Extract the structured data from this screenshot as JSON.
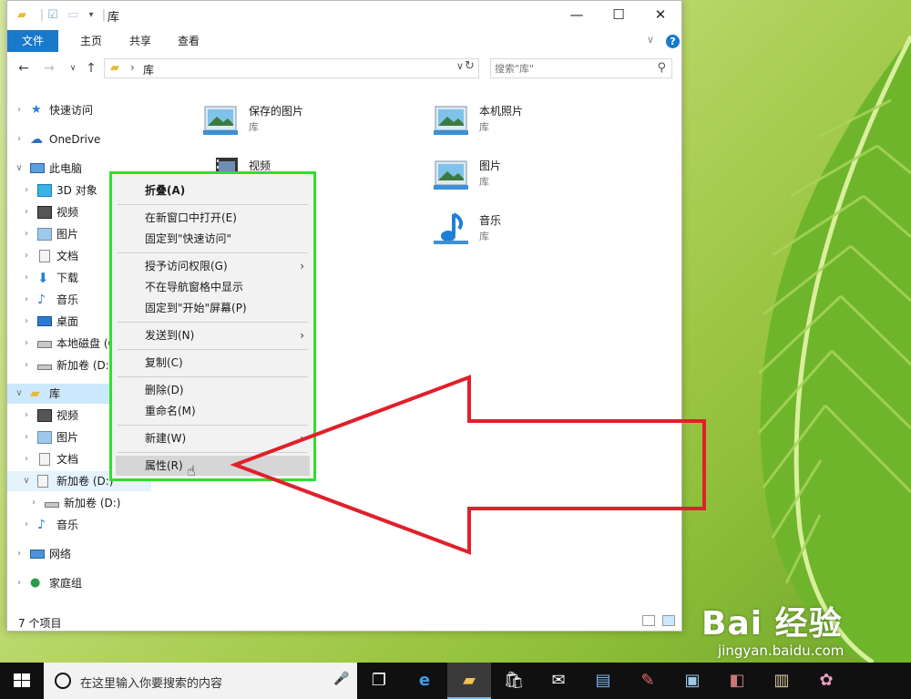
{
  "window": {
    "title": "库",
    "controls": {
      "minimize": "—",
      "maximize": "☐",
      "close": "✕"
    }
  },
  "ribbon": {
    "tabs": [
      {
        "label": "文件"
      },
      {
        "label": "主页"
      },
      {
        "label": "共享"
      },
      {
        "label": "查看"
      }
    ],
    "help": "?"
  },
  "address": {
    "path": "库",
    "separator": "›"
  },
  "search": {
    "placeholder": "搜索\"库\""
  },
  "nav_pane": {
    "items": [
      {
        "label": "快速访问",
        "icon": "star-icon"
      },
      {
        "label": "OneDrive",
        "icon": "cloud-icon"
      },
      {
        "label": "此电脑",
        "icon": "computer-icon"
      },
      {
        "label": "3D 对象",
        "icon": "cube-icon"
      },
      {
        "label": "视频",
        "icon": "video-icon"
      },
      {
        "label": "图片",
        "icon": "picture-icon"
      },
      {
        "label": "文档",
        "icon": "document-icon"
      },
      {
        "label": "下载",
        "icon": "download-icon"
      },
      {
        "label": "音乐",
        "icon": "music-icon"
      },
      {
        "label": "桌面",
        "icon": "desktop-icon"
      },
      {
        "label": "本地磁盘 (C",
        "icon": "drive-icon"
      },
      {
        "label": "新加卷 (D:)",
        "icon": "drive-icon"
      },
      {
        "label": "库",
        "icon": "library-icon"
      },
      {
        "label": "视频",
        "icon": "video-icon"
      },
      {
        "label": "图片",
        "icon": "picture-icon"
      },
      {
        "label": "文档",
        "icon": "document-icon"
      },
      {
        "label": "新加卷 (D:)",
        "icon": "drive-icon"
      },
      {
        "label": "新加卷 (D:)",
        "icon": "drive-icon"
      },
      {
        "label": "音乐",
        "icon": "music-icon"
      },
      {
        "label": "网络",
        "icon": "network-icon"
      },
      {
        "label": "家庭组",
        "icon": "homegroup-icon"
      }
    ]
  },
  "libraries": [
    {
      "name": "保存的图片",
      "type": "库"
    },
    {
      "name": "本机照片",
      "type": "库"
    },
    {
      "name": "视频",
      "type": "库"
    },
    {
      "name": "图片",
      "type": "库"
    },
    {
      "name": "音乐",
      "type": "库"
    }
  ],
  "context_menu": {
    "items": [
      {
        "label": "折叠(A)"
      },
      {
        "label": "在新窗口中打开(E)"
      },
      {
        "label": "固定到\"快速访问\""
      },
      {
        "label": "授予访问权限(G)"
      },
      {
        "label": "不在导航窗格中显示"
      },
      {
        "label": "固定到\"开始\"屏幕(P)"
      },
      {
        "label": "发送到(N)"
      },
      {
        "label": "复制(C)"
      },
      {
        "label": "删除(D)"
      },
      {
        "label": "重命名(M)"
      },
      {
        "label": "新建(W)"
      },
      {
        "label": "属性(R)"
      }
    ],
    "submenu_arrow": "›"
  },
  "status": {
    "count": "7 个项目"
  },
  "taskbar": {
    "search_text": "在这里输入你要搜索的内容"
  },
  "watermark": {
    "brand": "Bai 经验",
    "url": "jingyan.baidu.com"
  },
  "colors": {
    "accent": "#1979ca",
    "highlight_frame": "#2ee02e",
    "annotation_arrow": "#e0202a",
    "selection": "#cce8ff"
  }
}
